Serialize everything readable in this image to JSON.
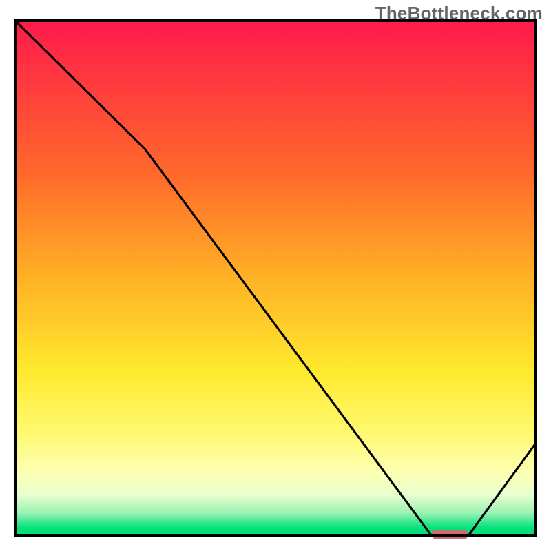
{
  "watermark": "TheBottleneck.com",
  "chart_data": {
    "type": "line",
    "title": "",
    "xlabel": "",
    "ylabel": "",
    "xlim": [
      0,
      100
    ],
    "ylim": [
      0,
      100
    ],
    "grid": false,
    "series": [
      {
        "name": "curve",
        "x": [
          0,
          25,
          80,
          82,
          87,
          100
        ],
        "y": [
          100,
          75,
          0,
          0,
          0,
          18
        ]
      }
    ],
    "optimal_marker": {
      "x_start": 80,
      "x_end": 87,
      "y": 0
    },
    "gradient_stops": [
      {
        "offset": 0.0,
        "color": "#ff1a4b"
      },
      {
        "offset": 0.3,
        "color": "#ff6a2b"
      },
      {
        "offset": 0.5,
        "color": "#ffb225"
      },
      {
        "offset": 0.68,
        "color": "#ffe92e"
      },
      {
        "offset": 0.8,
        "color": "#fff971"
      },
      {
        "offset": 0.88,
        "color": "#fdffb5"
      },
      {
        "offset": 0.92,
        "color": "#e8ffcf"
      },
      {
        "offset": 0.955,
        "color": "#9cf2b4"
      },
      {
        "offset": 0.985,
        "color": "#00e17a"
      },
      {
        "offset": 1.0,
        "color": "#00e17a"
      }
    ],
    "colors": {
      "curve": "#000000",
      "marker_fill": "#cf6a6f",
      "frame": "#000000"
    }
  }
}
